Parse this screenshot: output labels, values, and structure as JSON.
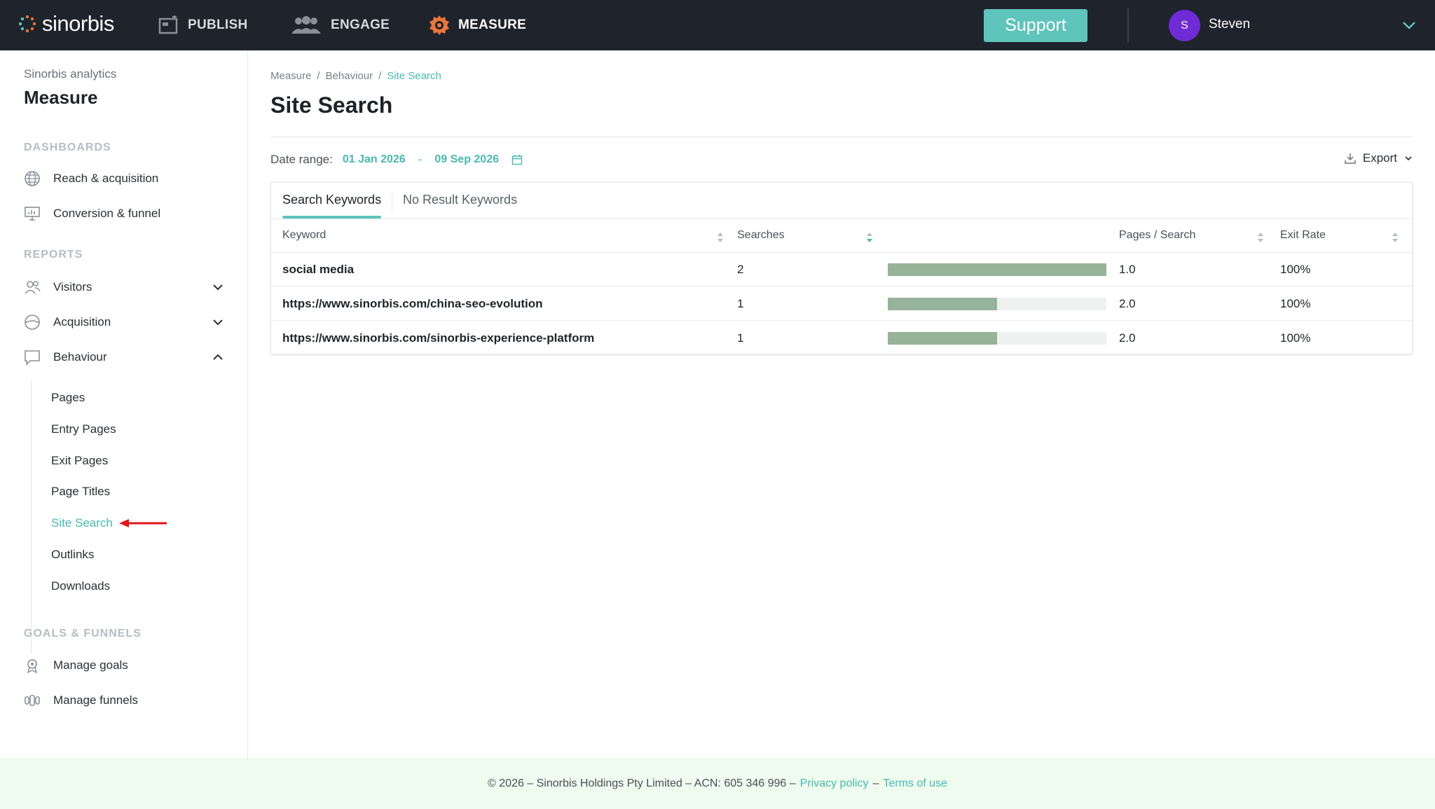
{
  "header": {
    "logo_text": "sinorbis",
    "nav": [
      {
        "label": "PUBLISH",
        "icon": "publish-icon",
        "active": false
      },
      {
        "label": "ENGAGE",
        "icon": "engage-icon",
        "active": false
      },
      {
        "label": "MEASURE",
        "icon": "measure-icon",
        "active": true
      }
    ],
    "support_label": "Support",
    "user": {
      "initial": "S",
      "name": "Steven"
    },
    "colors": {
      "bar": "#1f232b",
      "accent": "#5fc4bb",
      "measure_icon": "#e8773a",
      "avatar": "#6e2bd6"
    }
  },
  "sidebar": {
    "subtitle": "Sinorbis analytics",
    "title": "Measure",
    "sections": {
      "dashboards": "DASHBOARDS",
      "reports": "REPORTS",
      "goals": "GOALS & FUNNELS"
    },
    "dashboards": [
      {
        "label": "Reach & acquisition",
        "icon": "globe-icon"
      },
      {
        "label": "Conversion & funnel",
        "icon": "presentation-icon"
      }
    ],
    "reports": [
      {
        "label": "Visitors",
        "icon": "users-icon",
        "expanded": false
      },
      {
        "label": "Acquisition",
        "icon": "acquisition-icon",
        "expanded": false
      },
      {
        "label": "Behaviour",
        "icon": "chat-bubble-icon",
        "expanded": true
      }
    ],
    "behaviour_items": [
      "Pages",
      "Entry Pages",
      "Exit Pages",
      "Page Titles",
      "Site Search",
      "Outlinks",
      "Downloads"
    ],
    "active_item": "Site Search",
    "goals": [
      {
        "label": "Manage goals",
        "icon": "goal-badge-icon"
      },
      {
        "label": "Manage funnels",
        "icon": "funnel-icon"
      }
    ]
  },
  "main": {
    "breadcrumb": [
      "Measure",
      "Behaviour",
      "Site Search"
    ],
    "title": "Site Search",
    "date_label": "Date range:",
    "date_from": "01 Jan 2026",
    "date_sep": "-",
    "date_to": "09 Sep 2026",
    "export_label": "Export",
    "tabs": [
      "Search Keywords",
      "No Result Keywords"
    ],
    "active_tab": "Search Keywords",
    "columns": [
      "Keyword",
      "Searches",
      "Pages / Search",
      "Exit Rate"
    ],
    "rows": [
      {
        "keyword": "social media",
        "searches": "2",
        "bar_fraction": 1.0,
        "pages_per_search": "1.0",
        "exit_rate": "100%"
      },
      {
        "keyword": "https://www.sinorbis.com/china-seo-evolution",
        "searches": "1",
        "bar_fraction": 0.5,
        "pages_per_search": "2.0",
        "exit_rate": "100%"
      },
      {
        "keyword": "https://www.sinorbis.com/sinorbis-experience-platform",
        "searches": "1",
        "bar_fraction": 0.5,
        "pages_per_search": "2.0",
        "exit_rate": "100%"
      }
    ]
  },
  "footer": {
    "copyright": "© 2026 – Sinorbis Holdings Pty Limited – ACN: 605 346 996 –",
    "privacy": "Privacy policy",
    "dash": "–",
    "terms": "Terms of use"
  }
}
